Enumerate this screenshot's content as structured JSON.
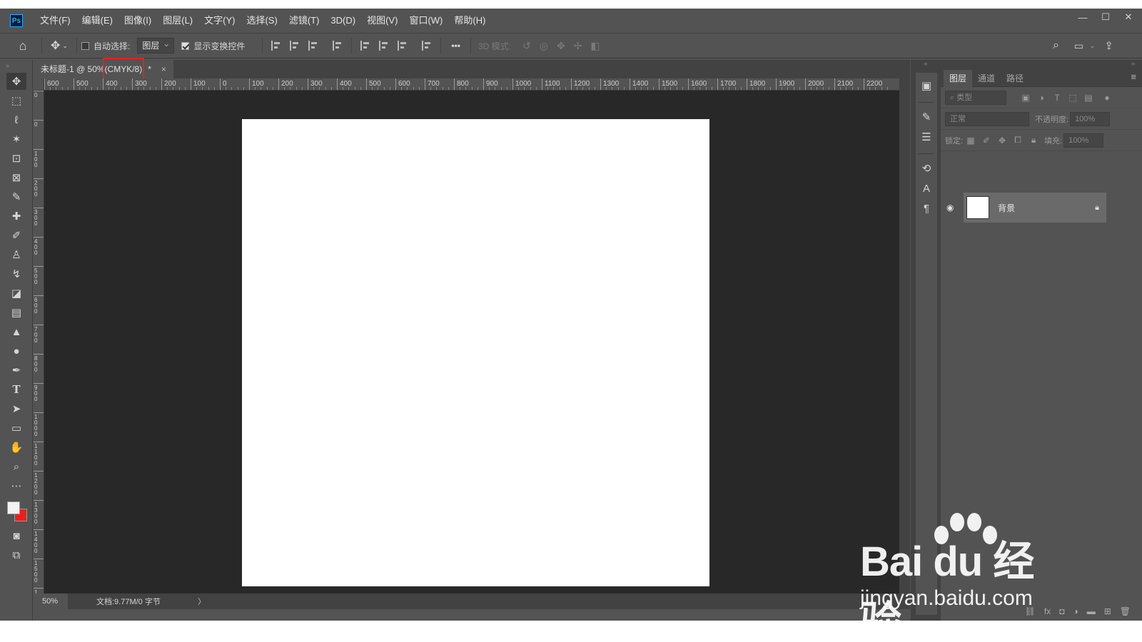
{
  "app": {
    "logo": "Ps"
  },
  "menu": [
    "文件(F)",
    "编辑(E)",
    "图像(I)",
    "图层(L)",
    "文字(Y)",
    "选择(S)",
    "滤镜(T)",
    "3D(D)",
    "视图(V)",
    "窗口(W)",
    "帮助(H)"
  ],
  "window_controls": {
    "minimize": "—",
    "maximize": "☐",
    "close": "✕"
  },
  "options": {
    "auto_select_label": "自动选择:",
    "auto_select_value": "图层",
    "show_transform_label": "显示变换控件",
    "more": "•••",
    "mode_3d_label": "3D 模式:"
  },
  "document_tab": {
    "name": "未标题-1 @ 50%",
    "mode": "(CMYK/8)",
    "modified": "*",
    "close": "×"
  },
  "ruler_h_labels": [
    "600",
    "500",
    "400",
    "300",
    "200",
    "100",
    "0",
    "100",
    "200",
    "300",
    "400",
    "500",
    "600",
    "700",
    "800",
    "900",
    "1000",
    "1100",
    "1200",
    "1300",
    "1400",
    "1500",
    "1600",
    "1700",
    "1800",
    "1900",
    "2000",
    "2100",
    "2200"
  ],
  "ruler_v_labels": [
    "0",
    "0",
    "1 0 0",
    "2 0 0",
    "3 0 0",
    "4 0 0",
    "5 0 0",
    "6 0 0",
    "7 0 0",
    "8 0 0",
    "9 0 0",
    "1 0 0 0",
    "1 1 0 0",
    "1 2 0 0",
    "1 3 0 0",
    "1 4 0 0",
    "1 5 0 0",
    "1 6 0 0"
  ],
  "status": {
    "zoom": "50%",
    "doc_info": "文档:9.77M/0 字节",
    "arrow": "〉"
  },
  "layers_panel": {
    "tabs": [
      "图层",
      "通道",
      "路径"
    ],
    "filter_placeholder": "类型",
    "blend_mode": "正常",
    "opacity_label": "不透明度:",
    "opacity_value": "100%",
    "lock_label": "锁定:",
    "fill_label": "填充:",
    "fill_value": "100%",
    "layers": [
      {
        "name": "背景"
      }
    ]
  },
  "colors": {
    "foreground": "#f2f2f2",
    "background": "#e81f1f",
    "highlight": "#e81f1f"
  },
  "watermark": {
    "brand": "Bai du 经验",
    "url": "jingyan.baidu.com"
  }
}
